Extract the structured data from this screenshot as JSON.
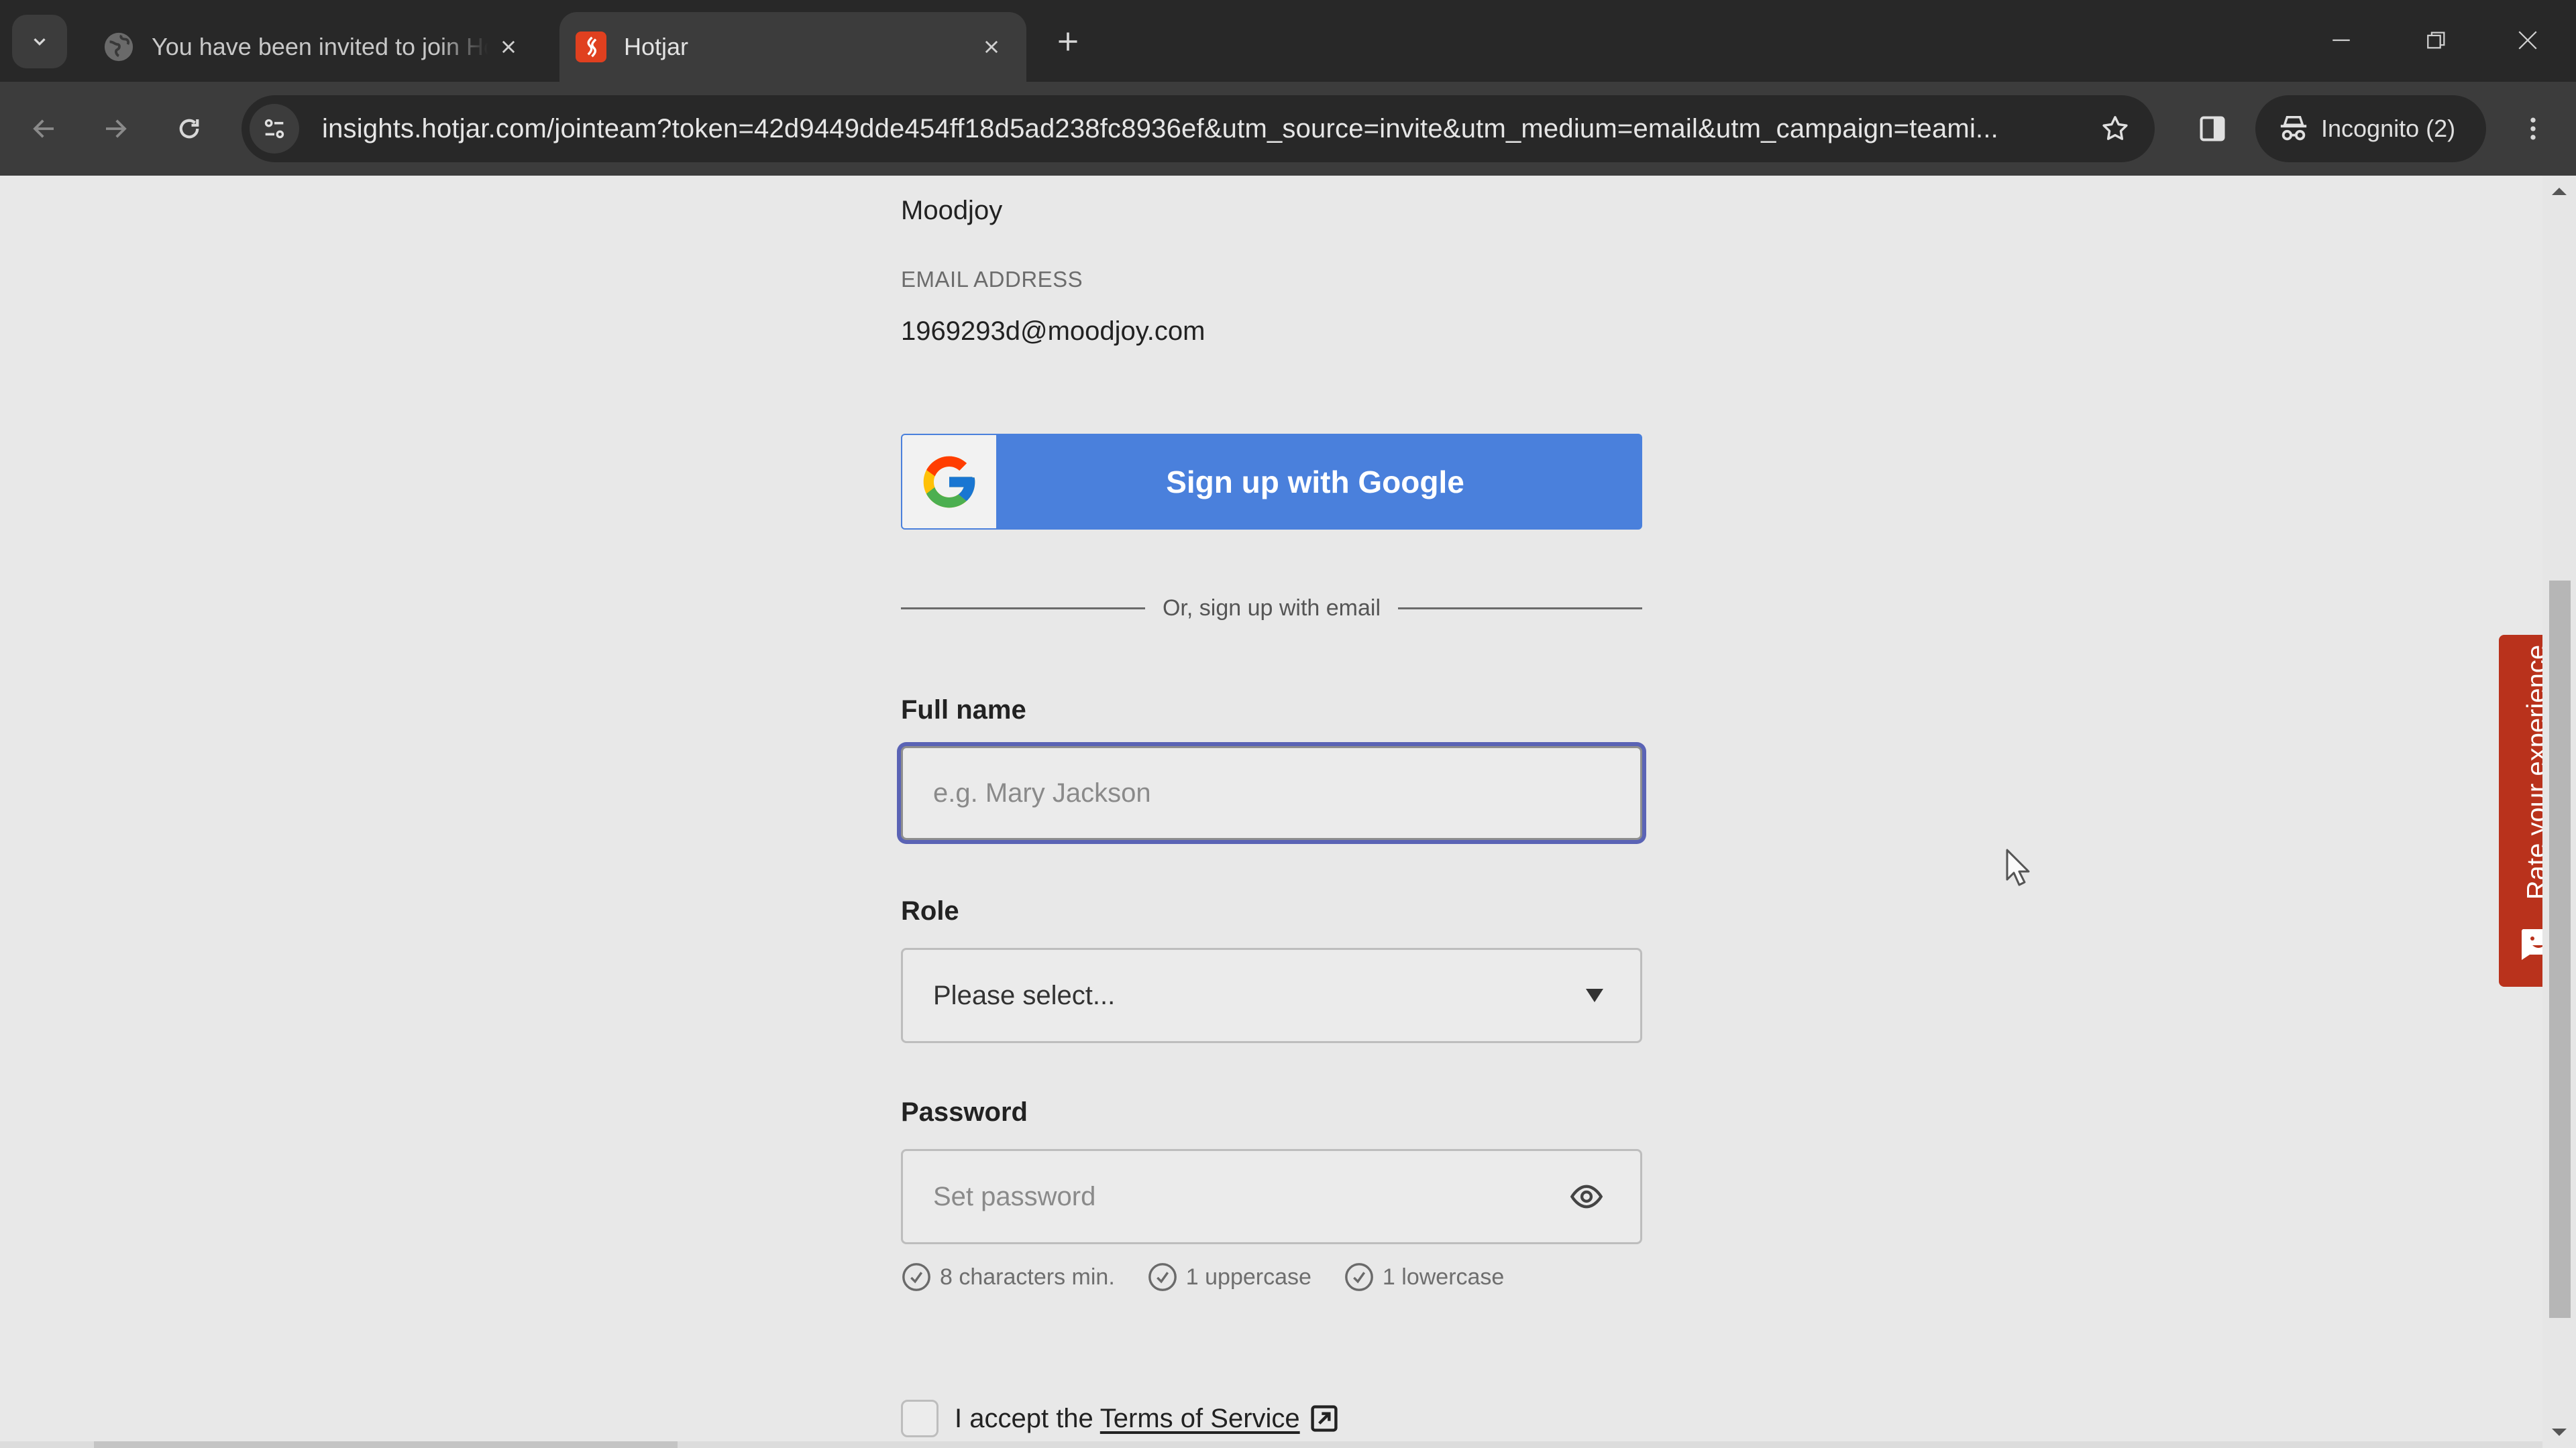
{
  "browser": {
    "tabs": [
      {
        "title": "You have been invited to join Hotjar",
        "active": false,
        "favicon": "globe-icon"
      },
      {
        "title": "Hotjar",
        "active": true,
        "favicon": "hotjar-logo-icon"
      }
    ],
    "url": "insights.hotjar.com/jointeam?token=42d9449dde454ff18d5ad238fc8936ef&utm_source=invite&utm_medium=email&utm_campaign=teami...",
    "incognito_label": "Incognito (2)",
    "icons": {
      "tab_search": "chevron-down-icon",
      "new_tab": "plus-icon",
      "back": "arrow-left-icon",
      "forward": "arrow-right-icon",
      "reload": "reload-icon",
      "site_info": "tune-icon",
      "bookmark": "star-icon",
      "side_panel": "side-panel-icon",
      "incognito": "incognito-icon",
      "menu": "more-vert-icon",
      "minimize": "minimize-icon",
      "restore": "restore-icon",
      "close": "close-icon"
    }
  },
  "page": {
    "company_name": "Moodjoy",
    "email_label": "EMAIL ADDRESS",
    "email_value": "1969293d@moodjoy.com",
    "google_button_label": "Sign up with Google",
    "divider_text": "Or, sign up with email",
    "full_name": {
      "label": "Full name",
      "placeholder": "e.g. Mary Jackson",
      "value": ""
    },
    "role": {
      "label": "Role",
      "selected": "Please select..."
    },
    "password": {
      "label": "Password",
      "placeholder": "Set password",
      "value": ""
    },
    "password_hints": [
      "8 characters min.",
      "1 uppercase",
      "1 lowercase"
    ],
    "tos": {
      "prefix": "I accept the",
      "link_text": "Terms of Service",
      "checked": false
    },
    "feedback_tab_label": "Rate your experience"
  },
  "colors": {
    "google_blue": "#4a80dc",
    "focus_ring": "#5a63b5",
    "feedback_red": "#b9321c",
    "hotjar_red": "#e0401f"
  }
}
